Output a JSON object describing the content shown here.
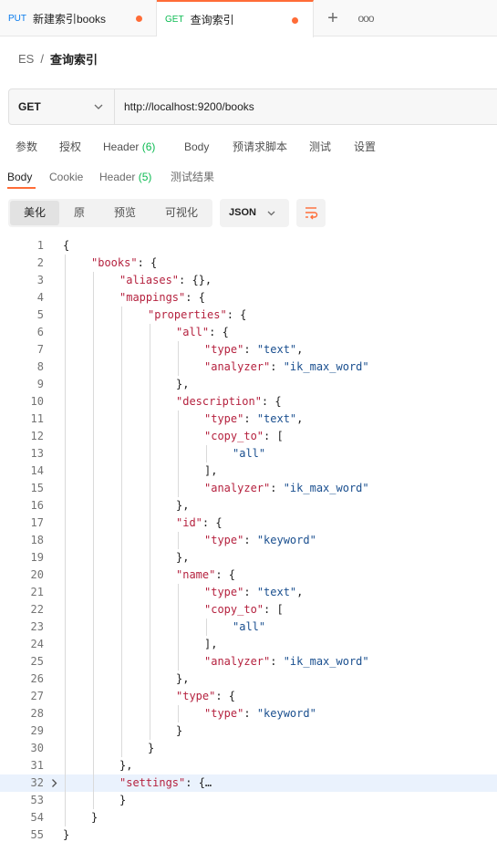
{
  "tabs": [
    {
      "method": "PUT",
      "title": "新建索引books",
      "unsaved": true
    },
    {
      "method": "GET",
      "title": "查询索引",
      "unsaved": true,
      "active": true
    }
  ],
  "tab_actions": {
    "new_tab": "+",
    "more": "ooo"
  },
  "breadcrumb": {
    "root": "ES",
    "separator": "/",
    "current": "查询索引"
  },
  "request": {
    "method": "GET",
    "url": "http://localhost:9200/books"
  },
  "request_tabs": [
    {
      "label": "参数"
    },
    {
      "label": "授权"
    },
    {
      "label": "Header",
      "count": "(6)"
    },
    {
      "label": "Body"
    },
    {
      "label": "预请求脚本"
    },
    {
      "label": "测试"
    },
    {
      "label": "设置"
    }
  ],
  "response_tabs": [
    {
      "label": "Body",
      "active": true
    },
    {
      "label": "Cookie"
    },
    {
      "label": "Header",
      "count": "(5)"
    },
    {
      "label": "测试结果"
    }
  ],
  "view_modes": [
    "美化",
    "原",
    "预览",
    "可视化"
  ],
  "active_view_mode": "美化",
  "format": "JSON",
  "colors": {
    "accent": "#ff6c37",
    "key": "#b5223f",
    "string": "#1a4f8f",
    "put": "#097bed",
    "get": "#0cbb52"
  },
  "code_lines": [
    {
      "n": "1",
      "indent": 0,
      "parts": [
        [
          "p",
          "{"
        ]
      ]
    },
    {
      "n": "2",
      "indent": 1,
      "parts": [
        [
          "k",
          "\"books\""
        ],
        [
          "p",
          ": {"
        ]
      ]
    },
    {
      "n": "3",
      "indent": 2,
      "parts": [
        [
          "k",
          "\"aliases\""
        ],
        [
          "p",
          ": {},"
        ]
      ]
    },
    {
      "n": "4",
      "indent": 2,
      "parts": [
        [
          "k",
          "\"mappings\""
        ],
        [
          "p",
          ": {"
        ]
      ]
    },
    {
      "n": "5",
      "indent": 3,
      "parts": [
        [
          "k",
          "\"properties\""
        ],
        [
          "p",
          ": {"
        ]
      ]
    },
    {
      "n": "6",
      "indent": 4,
      "parts": [
        [
          "k",
          "\"all\""
        ],
        [
          "p",
          ": {"
        ]
      ]
    },
    {
      "n": "7",
      "indent": 5,
      "parts": [
        [
          "k",
          "\"type\""
        ],
        [
          "p",
          ": "
        ],
        [
          "s",
          "\"text\""
        ],
        [
          "p",
          ","
        ]
      ]
    },
    {
      "n": "8",
      "indent": 5,
      "parts": [
        [
          "k",
          "\"analyzer\""
        ],
        [
          "p",
          ": "
        ],
        [
          "s",
          "\"ik_max_word\""
        ]
      ]
    },
    {
      "n": "9",
      "indent": 4,
      "parts": [
        [
          "p",
          "},"
        ]
      ]
    },
    {
      "n": "10",
      "indent": 4,
      "parts": [
        [
          "k",
          "\"description\""
        ],
        [
          "p",
          ": {"
        ]
      ]
    },
    {
      "n": "11",
      "indent": 5,
      "parts": [
        [
          "k",
          "\"type\""
        ],
        [
          "p",
          ": "
        ],
        [
          "s",
          "\"text\""
        ],
        [
          "p",
          ","
        ]
      ]
    },
    {
      "n": "12",
      "indent": 5,
      "parts": [
        [
          "k",
          "\"copy_to\""
        ],
        [
          "p",
          ": ["
        ]
      ]
    },
    {
      "n": "13",
      "indent": 6,
      "parts": [
        [
          "s",
          "\"all\""
        ]
      ]
    },
    {
      "n": "14",
      "indent": 5,
      "parts": [
        [
          "p",
          "],"
        ]
      ]
    },
    {
      "n": "15",
      "indent": 5,
      "parts": [
        [
          "k",
          "\"analyzer\""
        ],
        [
          "p",
          ": "
        ],
        [
          "s",
          "\"ik_max_word\""
        ]
      ]
    },
    {
      "n": "16",
      "indent": 4,
      "parts": [
        [
          "p",
          "},"
        ]
      ]
    },
    {
      "n": "17",
      "indent": 4,
      "parts": [
        [
          "k",
          "\"id\""
        ],
        [
          "p",
          ": {"
        ]
      ]
    },
    {
      "n": "18",
      "indent": 5,
      "parts": [
        [
          "k",
          "\"type\""
        ],
        [
          "p",
          ": "
        ],
        [
          "s",
          "\"keyword\""
        ]
      ]
    },
    {
      "n": "19",
      "indent": 4,
      "parts": [
        [
          "p",
          "},"
        ]
      ]
    },
    {
      "n": "20",
      "indent": 4,
      "parts": [
        [
          "k",
          "\"name\""
        ],
        [
          "p",
          ": {"
        ]
      ]
    },
    {
      "n": "21",
      "indent": 5,
      "parts": [
        [
          "k",
          "\"type\""
        ],
        [
          "p",
          ": "
        ],
        [
          "s",
          "\"text\""
        ],
        [
          "p",
          ","
        ]
      ]
    },
    {
      "n": "22",
      "indent": 5,
      "parts": [
        [
          "k",
          "\"copy_to\""
        ],
        [
          "p",
          ": ["
        ]
      ]
    },
    {
      "n": "23",
      "indent": 6,
      "parts": [
        [
          "s",
          "\"all\""
        ]
      ]
    },
    {
      "n": "24",
      "indent": 5,
      "parts": [
        [
          "p",
          "],"
        ]
      ]
    },
    {
      "n": "25",
      "indent": 5,
      "parts": [
        [
          "k",
          "\"analyzer\""
        ],
        [
          "p",
          ": "
        ],
        [
          "s",
          "\"ik_max_word\""
        ]
      ]
    },
    {
      "n": "26",
      "indent": 4,
      "parts": [
        [
          "p",
          "},"
        ]
      ]
    },
    {
      "n": "27",
      "indent": 4,
      "parts": [
        [
          "k",
          "\"type\""
        ],
        [
          "p",
          ": {"
        ]
      ]
    },
    {
      "n": "28",
      "indent": 5,
      "parts": [
        [
          "k",
          "\"type\""
        ],
        [
          "p",
          ": "
        ],
        [
          "s",
          "\"keyword\""
        ]
      ]
    },
    {
      "n": "29",
      "indent": 4,
      "parts": [
        [
          "p",
          "}"
        ]
      ]
    },
    {
      "n": "30",
      "indent": 3,
      "parts": [
        [
          "p",
          "}"
        ]
      ]
    },
    {
      "n": "31",
      "indent": 2,
      "parts": [
        [
          "p",
          "},"
        ]
      ]
    },
    {
      "n": "32",
      "indent": 2,
      "parts": [
        [
          "k",
          "\"settings\""
        ],
        [
          "p",
          ": {…"
        ]
      ],
      "folded": true
    },
    {
      "n": "53",
      "indent": 2,
      "parts": [
        [
          "p",
          "}"
        ]
      ]
    },
    {
      "n": "54",
      "indent": 1,
      "parts": [
        [
          "p",
          "}"
        ]
      ]
    },
    {
      "n": "55",
      "indent": 0,
      "parts": [
        [
          "p",
          "}"
        ]
      ]
    }
  ]
}
